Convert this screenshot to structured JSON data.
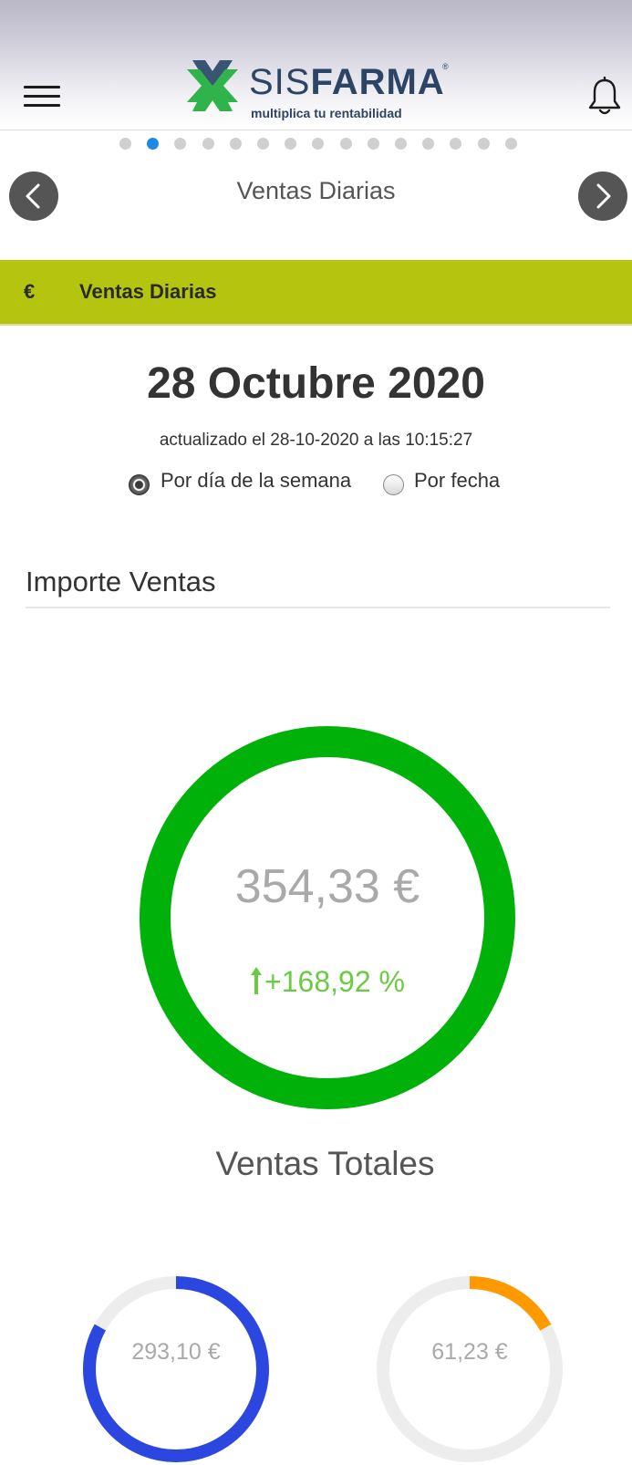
{
  "header": {
    "brand_part1": "SIS",
    "brand_part2": "FARMA",
    "registered": "®",
    "tagline": "multiplica tu rentabilidad"
  },
  "carousel": {
    "dot_count": 15,
    "active_index": 1,
    "slide_title": "Ventas Diarias"
  },
  "section": {
    "currency_symbol": "€",
    "label": "Ventas Diarias"
  },
  "report": {
    "date": "28 Octubre 2020",
    "updated": "actualizado el 28-10-2020 a las 10:15:27",
    "filter_options": [
      {
        "label": "Por día de la semana",
        "checked": true
      },
      {
        "label": "Por fecha",
        "checked": false
      }
    ]
  },
  "importe": {
    "title": "Importe Ventas",
    "total_value": "354,33 €",
    "change": "+168,92 %",
    "caption": "Ventas Totales"
  },
  "breakdown": [
    {
      "value": "293,10 €",
      "fraction": 0.83
    },
    {
      "value": "61,23 €",
      "fraction": 0.17
    }
  ],
  "colors": {
    "accent_bar": "#b5c40f",
    "ring_total": "#00b10a",
    "change_positive": "#6acb43",
    "ring_blue": "#2b47e0",
    "ring_orange": "#ff9900",
    "ring_track": "#ededed",
    "active_dot": "#1e88e5"
  },
  "icons": {
    "menu": "hamburger-menu-icon",
    "notifications": "bell-icon",
    "previous": "chevron-left-icon",
    "next": "chevron-right-icon",
    "change": "arrow-up-icon"
  }
}
